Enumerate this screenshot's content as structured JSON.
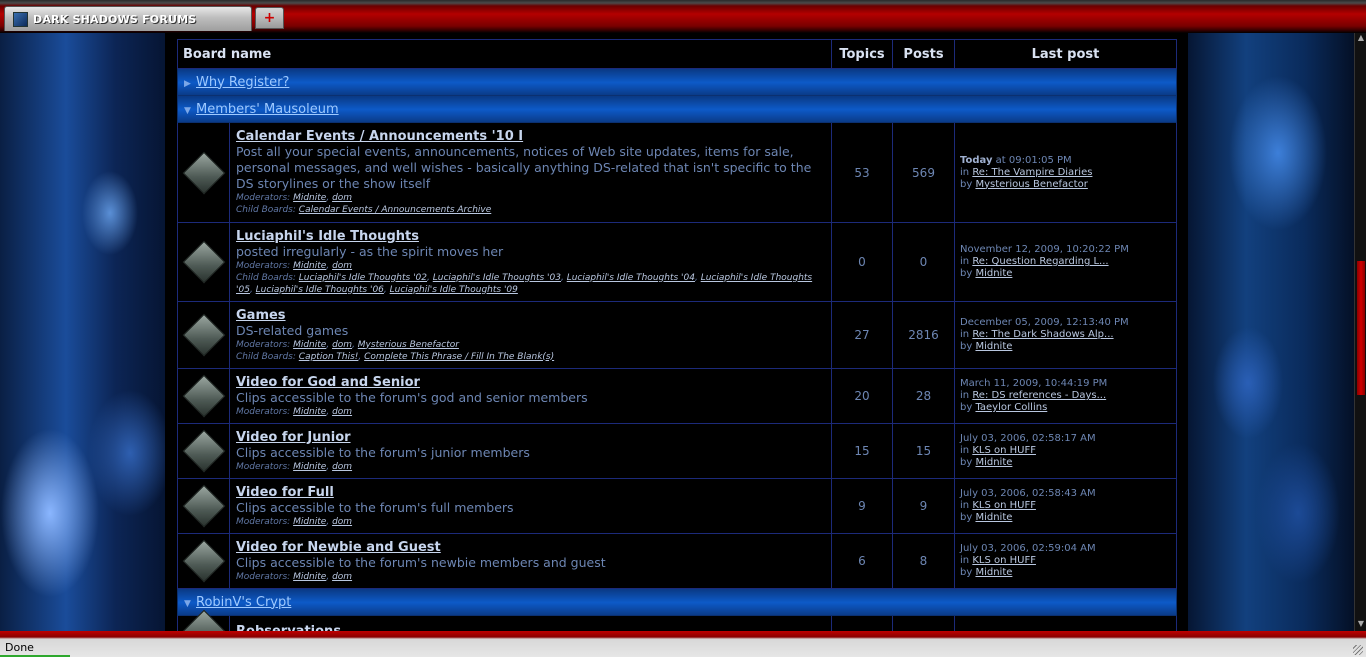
{
  "browser": {
    "tab_title": "DARK SHADOWS FORUMS",
    "new_tab_label": "+",
    "status": "Done"
  },
  "table": {
    "headers": {
      "board": "Board name",
      "topics": "Topics",
      "posts": "Posts",
      "last": "Last post"
    }
  },
  "categories": [
    {
      "name": "Why Register?",
      "collapsed": true
    },
    {
      "name": "Members' Mausoleum",
      "collapsed": false
    },
    {
      "name": "RobinV's Crypt",
      "collapsed": false
    }
  ],
  "labels": {
    "moderators": "Moderators:",
    "child_boards": "Child Boards:",
    "in": "in",
    "by": "by"
  },
  "boards": [
    {
      "name": "Calendar Events / Announcements '10 I",
      "desc": "Post all your special events, announcements, notices of Web site updates, items for sale, personal messages, and well wishes - basically anything DS-related that isn't specific to the DS storylines or the show itself",
      "mods": [
        "Midnite",
        "dom"
      ],
      "children": [
        "Calendar Events / Announcements Archive"
      ],
      "topics": "53",
      "posts": "569",
      "last_today": "Today",
      "last_date": " at 09:01:05 PM",
      "last_topic": "Re: The Vampire Diaries",
      "last_by": "Mysterious Benefactor"
    },
    {
      "name": "Luciaphil's Idle Thoughts",
      "desc": "posted irregularly - as the spirit moves her",
      "mods": [
        "Midnite",
        "dom"
      ],
      "children": [
        "Luciaphil's Idle Thoughts '02",
        "Luciaphil's Idle Thoughts '03",
        "Luciaphil's Idle Thoughts '04",
        "Luciaphil's Idle Thoughts '05",
        "Luciaphil's Idle Thoughts '06",
        "Luciaphil's Idle Thoughts '09"
      ],
      "topics": "0",
      "posts": "0",
      "last_date": "November 12, 2009, 10:20:22 PM",
      "last_topic": "Re: Question Regarding L...",
      "last_by": "Midnite"
    },
    {
      "name": "Games",
      "desc": "DS-related games",
      "mods": [
        "Midnite",
        "dom",
        "Mysterious Benefactor"
      ],
      "children": [
        "Caption This!",
        "Complete This Phrase / Fill In The Blank(s)"
      ],
      "topics": "27",
      "posts": "2816",
      "last_date": "December 05, 2009, 12:13:40 PM",
      "last_topic": "Re: The Dark Shadows Alp...",
      "last_by": "Midnite"
    },
    {
      "name": "Video for God and Senior",
      "desc": "Clips accessible to the forum's god and senior members",
      "mods": [
        "Midnite",
        "dom"
      ],
      "topics": "20",
      "posts": "28",
      "last_date": "March 11, 2009, 10:44:19 PM",
      "last_topic": "Re: DS references - Days...",
      "last_by": "Taeylor Collins"
    },
    {
      "name": "Video for Junior",
      "desc": "Clips accessible to the forum's junior members",
      "mods": [
        "Midnite",
        "dom"
      ],
      "topics": "15",
      "posts": "15",
      "last_date": "July 03, 2006, 02:58:17 AM",
      "last_topic": "KLS on HUFF",
      "last_by": "Midnite"
    },
    {
      "name": "Video for Full",
      "desc": "Clips accessible to the forum's full members",
      "mods": [
        "Midnite",
        "dom"
      ],
      "topics": "9",
      "posts": "9",
      "last_date": "July 03, 2006, 02:58:43 AM",
      "last_topic": "KLS on HUFF",
      "last_by": "Midnite"
    },
    {
      "name": "Video for Newbie and Guest",
      "desc": "Clips accessible to the forum's newbie members and guest",
      "mods": [
        "Midnite",
        "dom"
      ],
      "topics": "6",
      "posts": "8",
      "last_date": "July 03, 2006, 02:59:04 AM",
      "last_topic": "KLS on HUFF",
      "last_by": "Midnite"
    },
    {
      "name": "Robservations"
    }
  ]
}
